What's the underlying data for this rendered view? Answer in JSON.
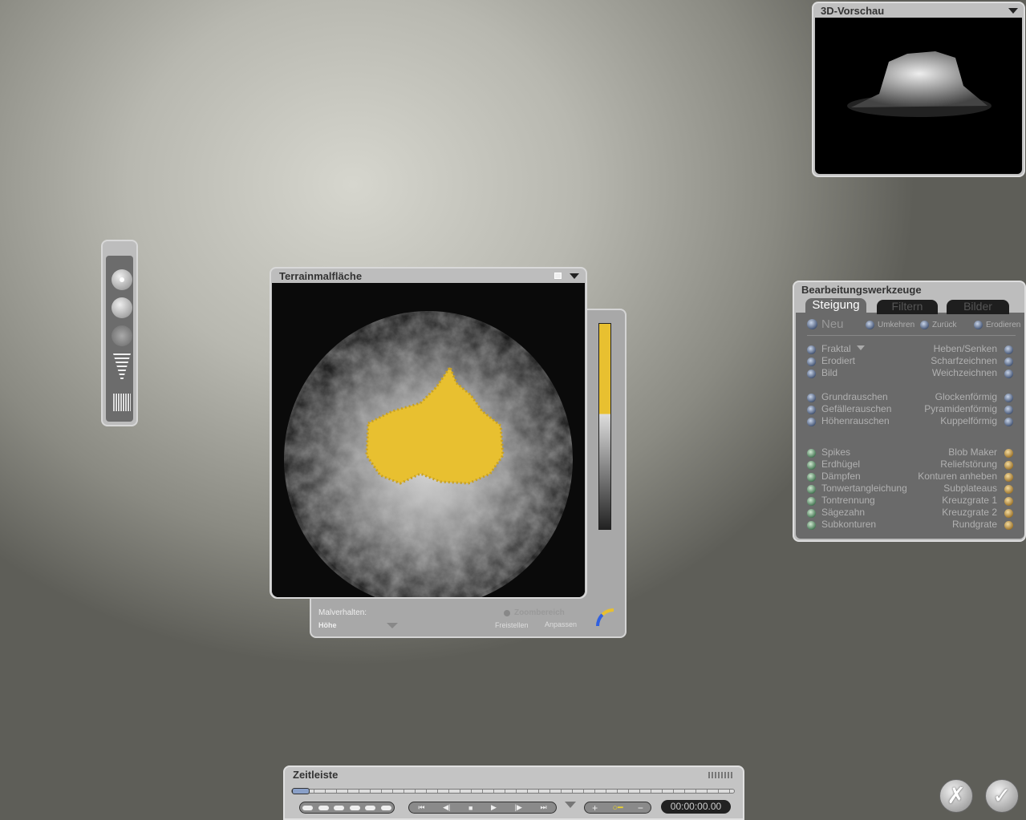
{
  "terrain": {
    "title": "Terrainmalfläche",
    "paint_mode_label": "Malverhalten:",
    "paint_mode_value": "Höhe",
    "zoom_label": "Zoombereich",
    "crop": "Freistellen",
    "fit": "Anpassen"
  },
  "preview": {
    "title": "3D-Vorschau"
  },
  "tools": {
    "title": "Bearbeitungswerkzeuge",
    "tabs": [
      {
        "label": "Steigung",
        "active": true
      },
      {
        "label": "Filtern"
      },
      {
        "label": "Bilder"
      }
    ],
    "top": {
      "new": "Neu",
      "invert": "Umkehren",
      "undo": "Zurück",
      "erode": "Erodieren"
    },
    "left": [
      "Fraktal",
      "Erodiert",
      "Bild",
      "Grundrauschen",
      "Gefällerauschen",
      "Höhenrauschen",
      "Spikes",
      "Erdhügel",
      "Dämpfen",
      "Tonwertangleichung",
      "Tontrennung",
      "Sägezahn",
      "Subkonturen"
    ],
    "right": [
      "Heben/Senken",
      "Scharfzeichnen",
      "Weichzeichnen",
      "Glockenförmig",
      "Pyramidenförmig",
      "Kuppelförmig",
      "Blob Maker",
      "Reliefstörung",
      "Konturen anheben",
      "Subplateaus",
      "Kreuzgrate 1",
      "Kreuzgrate 2",
      "Rundgrate"
    ]
  },
  "timeline": {
    "title": "Zeitleiste",
    "time": "00:00:00.00",
    "transport": [
      "⏮",
      "◀|",
      "■",
      "▶",
      "|▶",
      "⏭"
    ],
    "key": {
      "add": "+",
      "remove": "−"
    }
  },
  "actions": {
    "cancel": "✗",
    "ok": "✓"
  },
  "colors": {
    "accent": "#e8c030"
  }
}
